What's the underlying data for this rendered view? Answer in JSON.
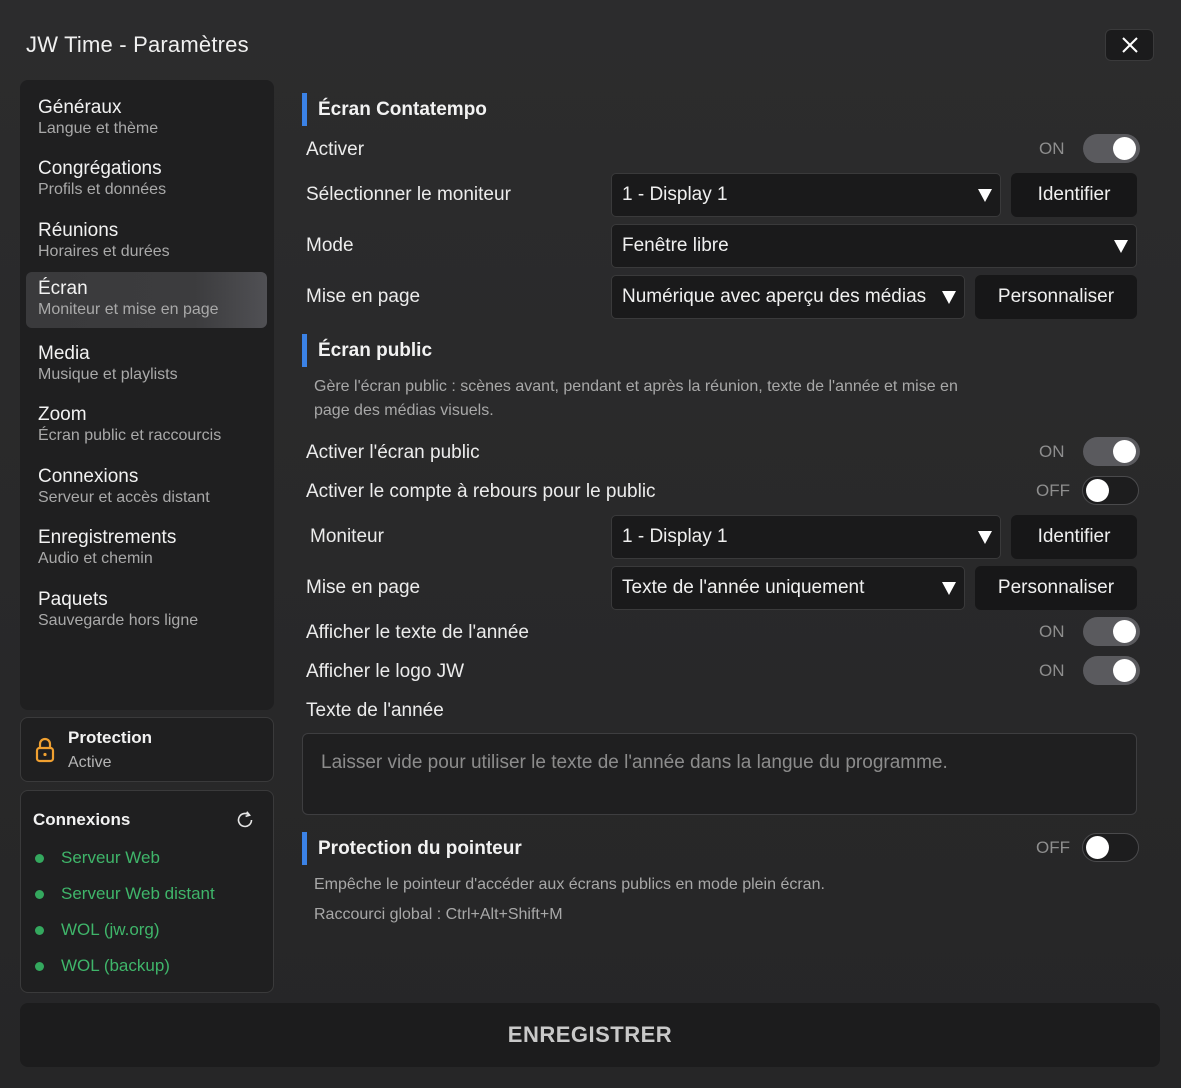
{
  "window": {
    "title": "JW Time - Paramètres"
  },
  "sidebar": {
    "items": [
      {
        "title": "Généraux",
        "subtitle": "Langue et thème"
      },
      {
        "title": "Congrégations",
        "subtitle": "Profils et données"
      },
      {
        "title": "Réunions",
        "subtitle": "Horaires et durées"
      },
      {
        "title": "Écran",
        "subtitle": "Moniteur et mise en page",
        "active": true
      },
      {
        "title": "Media",
        "subtitle": "Musique et playlists"
      },
      {
        "title": "Zoom",
        "subtitle": "Écran public et raccourcis"
      },
      {
        "title": "Connexions",
        "subtitle": "Serveur et accès distant"
      },
      {
        "title": "Enregistrements",
        "subtitle": "Audio et chemin"
      },
      {
        "title": "Paquets",
        "subtitle": "Sauvegarde hors ligne"
      }
    ]
  },
  "protection": {
    "title": "Protection",
    "status": "Active"
  },
  "connections": {
    "title": "Connexions",
    "items": [
      "Serveur Web",
      "Serveur Web distant",
      "WOL (jw.org)",
      "WOL (backup)"
    ],
    "status_color": "#34a85e"
  },
  "contatempo": {
    "heading": "Écran Contatempo",
    "activate_label": "Activer",
    "activate_state": "ON",
    "monitor_label": "Sélectionner le moniteur",
    "monitor_value": "1 - Display 1",
    "identify_label": "Identifier",
    "mode_label": "Mode",
    "mode_value": "Fenêtre libre",
    "layout_label": "Mise en page",
    "layout_value": "Numérique avec aperçu des médias",
    "customize_label": "Personnaliser"
  },
  "public_screen": {
    "heading": "Écran public",
    "description_line1": "Gère l'écran public : scènes avant, pendant et après la réunion, texte de l'année et mise en",
    "description_line2": "page des médias visuels.",
    "activate_label": "Activer l'écran public",
    "activate_state": "ON",
    "countdown_label": "Activer le compte à rebours pour le public",
    "countdown_state": "OFF",
    "monitor_label": "Moniteur",
    "monitor_value": "1 - Display 1",
    "identify_label": "Identifier",
    "layout_label": "Mise en page",
    "layout_value": "Texte de l'année uniquement",
    "customize_label": "Personnaliser",
    "show_yeartext_label": "Afficher le texte de l'année",
    "show_yeartext_state": "ON",
    "show_logo_label": "Afficher le logo JW",
    "show_logo_state": "ON",
    "yeartext_label": "Texte de l'année",
    "yeartext_placeholder": "Laisser vide pour utiliser le texte de l'année dans la langue du programme."
  },
  "pointer_protection": {
    "heading": "Protection du pointeur",
    "state": "OFF",
    "description": "Empêche le pointeur d'accéder aux écrans publics en mode plein écran.",
    "shortcut": "Raccourci global : Ctrl+Alt+Shift+M"
  },
  "footer": {
    "save_label": "ENREGISTRER"
  },
  "colors": {
    "accent": "#3b82e6",
    "success": "#3fb56a",
    "lock": "#f0a030"
  }
}
